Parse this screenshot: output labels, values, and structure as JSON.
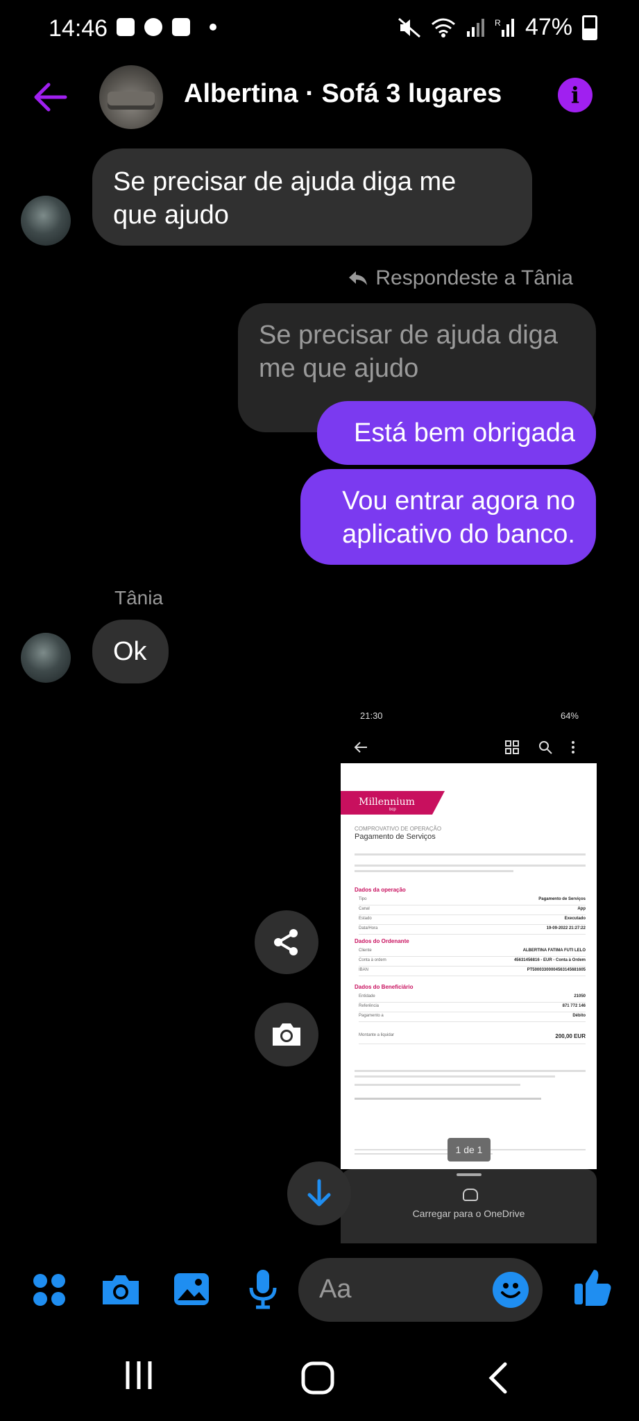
{
  "status_bar": {
    "time": "14:46",
    "battery": "47%"
  },
  "header": {
    "title": "Albertina · Sofá 3 lugares",
    "back_icon": "back-arrow-icon",
    "info_icon": "info-icon",
    "info_glyph": "i"
  },
  "messages": {
    "m1": {
      "lines": [
        "Se precisar de ajuda diga me",
        "que ajudo"
      ]
    },
    "reply_note": "Respondeste a Tânia",
    "quoted": {
      "lines": [
        "Se precisar de ajuda diga",
        "me que ajudo"
      ]
    },
    "m2": "Está bem obrigada",
    "m3": {
      "lines": [
        "Vou entrar agora no",
        "aplicativo do banco."
      ]
    },
    "sender_name": "Tânia",
    "m4": "Ok"
  },
  "attachment": {
    "status_time": "21:30",
    "status_battery": "64%",
    "brand": "Millennium",
    "brand_sub": "bcp",
    "doc_kicker": "COMPROVATIVO DE OPERAÇÃO",
    "doc_title": "Pagamento de Serviços",
    "section_operation": "Dados da operação",
    "section_ordering": "Dados do Ordenante",
    "section_beneficiary": "Dados do Beneficiário",
    "op_rows": [
      {
        "k": "Tipo",
        "v": "Pagamento de Serviços"
      },
      {
        "k": "Canal",
        "v": "App"
      },
      {
        "k": "Estado",
        "v": "Executado"
      },
      {
        "k": "Data/Hora",
        "v": "19-09-2022 21:27:22"
      }
    ],
    "ord_rows": [
      {
        "k": "Cliente",
        "v": "ALBERTINA FATIMA FUTI LELO"
      },
      {
        "k": "Conta à ordem",
        "v": "45631456816 - EUR - Conta à Ordem"
      },
      {
        "k": "IBAN",
        "v": "PT50003300004563145681605"
      }
    ],
    "ben_rows": [
      {
        "k": "Entidade",
        "v": "21050"
      },
      {
        "k": "Referência",
        "v": "871 772 146"
      },
      {
        "k": "Pagamento a",
        "v": "Débito"
      }
    ],
    "amount_label": "Montante a liquidar",
    "amount_value": "200,00 EUR",
    "page_indicator": "1 de 1",
    "upload_label": "Carregar para o OneDrive"
  },
  "composer": {
    "placeholder": "Aa"
  },
  "icons": {
    "apps": "apps-grid-icon",
    "camera": "camera-icon",
    "gallery": "image-icon",
    "mic": "microphone-icon",
    "emoji": "emoji-icon",
    "like": "thumbs-up-icon",
    "share": "share-icon",
    "screenshot": "camera-icon",
    "scroll_down": "arrow-down-icon"
  },
  "colors": {
    "accent_purple": "#7b3af0",
    "messenger_blue": "#1f8ef1",
    "header_purple": "#a020f0",
    "bank_brand": "#c8105e"
  }
}
